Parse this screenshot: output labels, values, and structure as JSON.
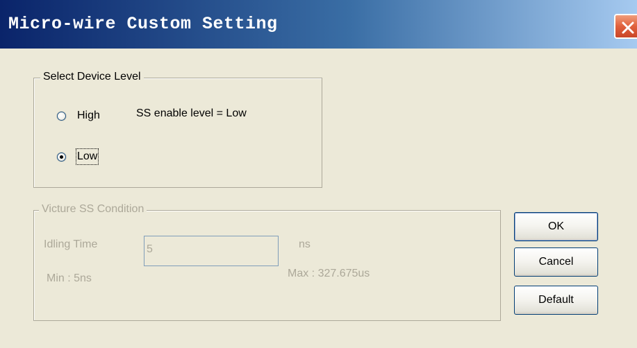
{
  "window": {
    "title": "Micro-wire Custom Setting"
  },
  "device_level": {
    "legend": "Select Device Level",
    "options": [
      {
        "label": "High",
        "checked": false
      },
      {
        "label": "Low",
        "checked": true
      }
    ],
    "ss_enable_text": "SS enable level  = Low"
  },
  "ss_condition": {
    "legend": "Victure SS Condition",
    "idling_label": "Idling Time",
    "idling_value": "5",
    "unit": "ns",
    "min_text": "Min : 5ns",
    "max_text": "Max : 327.675us",
    "enabled": false
  },
  "buttons": {
    "ok": "OK",
    "cancel": "Cancel",
    "default": "Default"
  },
  "colors": {
    "face": "#ECE9D8",
    "title_start": "#0A246A",
    "disabled_text": "#ACA899",
    "close_button": "#E0603D"
  },
  "icons": {
    "close": "close-icon"
  }
}
